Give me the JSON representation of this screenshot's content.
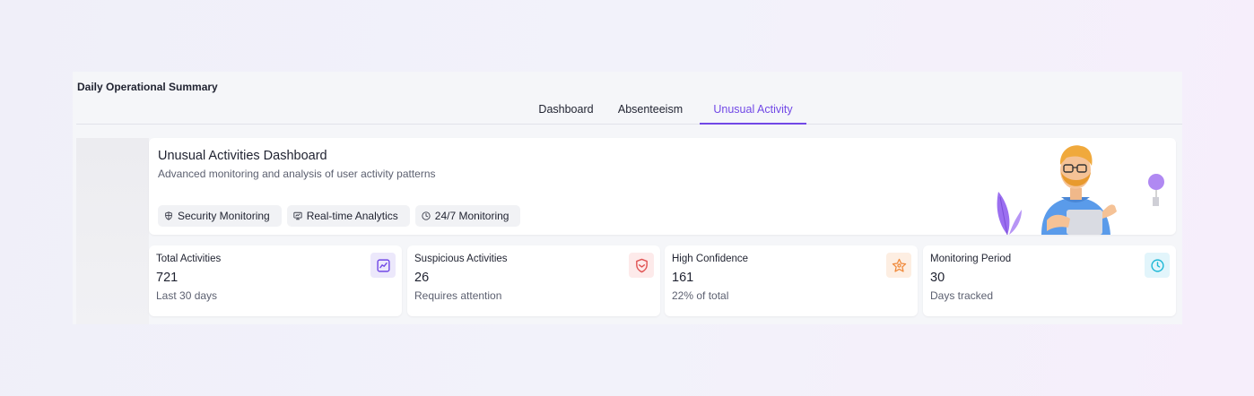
{
  "panel": {
    "title": "Daily Operational Summary"
  },
  "tabs": [
    {
      "label": "Dashboard",
      "active": false
    },
    {
      "label": "Absenteeism",
      "active": false
    },
    {
      "label": "Unusual Activity",
      "active": true
    }
  ],
  "hero": {
    "title": "Unusual Activities Dashboard",
    "subtitle": "Advanced monitoring and analysis of user activity patterns",
    "chips": [
      {
        "label": "Security Monitoring",
        "icon": "shield-icon"
      },
      {
        "label": "Real-time Analytics",
        "icon": "monitor-icon"
      },
      {
        "label": "24/7 Monitoring",
        "icon": "clock-icon"
      }
    ]
  },
  "stats": [
    {
      "label": "Total Activities",
      "value": "721",
      "sub": "Last 30 days",
      "icon": "trend-chart-icon",
      "icon_color": "#7148e6",
      "icon_bg": "#ece8fb"
    },
    {
      "label": "Suspicious Activities",
      "value": "26",
      "sub": "Requires attention",
      "icon": "shield-alert-icon",
      "icon_color": "#e05252",
      "icon_bg": "#fdeaea"
    },
    {
      "label": "High Confidence",
      "value": "161",
      "sub": "22% of total",
      "icon": "award-star-icon",
      "icon_color": "#f08a3c",
      "icon_bg": "#fdeee2"
    },
    {
      "label": "Monitoring Period",
      "value": "30",
      "sub": "Days tracked",
      "icon": "clock-icon",
      "icon_color": "#1fb8d6",
      "icon_bg": "#e2f5fb"
    }
  ],
  "colors": {
    "accent": "#7148e6",
    "danger": "#e05252",
    "warning": "#f08a3c",
    "info": "#1fb8d6"
  }
}
